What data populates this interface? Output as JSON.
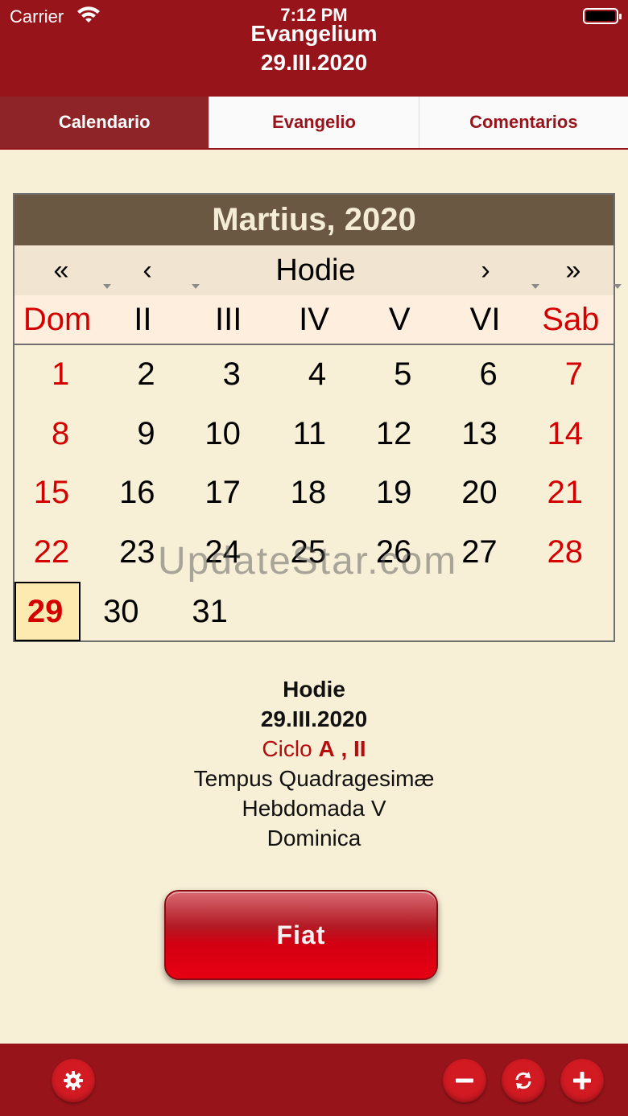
{
  "status": {
    "carrier": "Carrier",
    "time": "7:12 PM"
  },
  "header": {
    "title": "Evangelium",
    "date": "29.III.2020"
  },
  "tabs": [
    {
      "label": "Calendario",
      "active": true
    },
    {
      "label": "Evangelio",
      "active": false
    },
    {
      "label": "Comentarios",
      "active": false
    }
  ],
  "calendar": {
    "month_title": "Martius, 2020",
    "nav": {
      "first": "«",
      "prev": "‹",
      "today": "Hodie",
      "next": "›",
      "last": "»"
    },
    "weekdays": [
      "Dom",
      "II",
      "III",
      "IV",
      "V",
      "VI",
      "Sab"
    ],
    "weeks": [
      [
        "1",
        "2",
        "3",
        "4",
        "5",
        "6",
        "7"
      ],
      [
        "8",
        "9",
        "10",
        "11",
        "12",
        "13",
        "14"
      ],
      [
        "15",
        "16",
        "17",
        "18",
        "19",
        "20",
        "21"
      ],
      [
        "22",
        "23",
        "24",
        "25",
        "26",
        "27",
        "28"
      ],
      [
        "29",
        "30",
        "31",
        "",
        "",
        "",
        ""
      ]
    ],
    "today": "29"
  },
  "watermark": "UpdateStar.com",
  "info": {
    "line1": "Hodie",
    "line2": "29.III.2020",
    "ciclo_label": "Ciclo",
    "ciclo_a": "A",
    "ciclo_sep": ",",
    "ciclo_b": "II",
    "line4": "Tempus Quadragesimæ",
    "line5": "Hebdomada V",
    "line6": "Dominica"
  },
  "fiat_label": "Fiat",
  "footer": {
    "icons": [
      "gear-icon",
      "minus-icon",
      "refresh-icon",
      "plus-icon"
    ]
  },
  "colors": {
    "header": "#97141a",
    "accent_red": "#d40000",
    "background": "#f7efd6"
  }
}
